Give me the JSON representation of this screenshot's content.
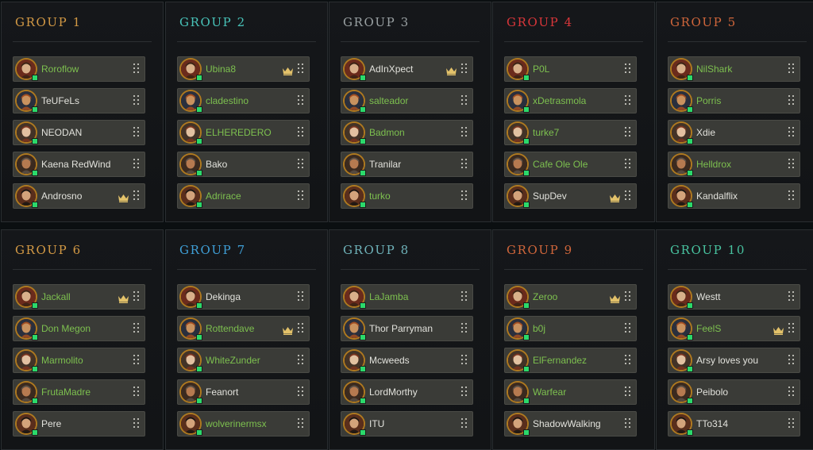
{
  "colors": {
    "gold": "#d49a45",
    "teal": "#48c3b9",
    "grey": "#9aa1a3",
    "red": "#d9363a",
    "orange": "#d0663b",
    "blue": "#3f9fd7",
    "online": "#2bd96b",
    "name_green": "#7dc04f",
    "name_white": "#e2e2dc"
  },
  "groups": [
    {
      "title": "GROUP 1",
      "color": "#d49a45",
      "players": [
        {
          "name": "Roroflow",
          "green": true,
          "crown": false,
          "avatar": "avatar-icon"
        },
        {
          "name": "TeUFeLs",
          "green": false,
          "crown": false,
          "avatar": "avatar-icon"
        },
        {
          "name": "NEODAN",
          "green": false,
          "crown": false,
          "avatar": "avatar-icon"
        },
        {
          "name": "Kaena RedWind",
          "green": false,
          "crown": false,
          "avatar": "avatar-icon"
        },
        {
          "name": "Androsno",
          "green": false,
          "crown": true,
          "avatar": "avatar-icon"
        }
      ]
    },
    {
      "title": "GROUP 2",
      "color": "#48c3b9",
      "players": [
        {
          "name": "Ubina8",
          "green": true,
          "crown": true,
          "avatar": "avatar-icon"
        },
        {
          "name": "cladestino",
          "green": true,
          "crown": false,
          "avatar": "avatar-icon"
        },
        {
          "name": "ELHEREDERO",
          "green": true,
          "crown": false,
          "avatar": "avatar-icon"
        },
        {
          "name": "Bako",
          "green": false,
          "crown": false,
          "avatar": "avatar-icon"
        },
        {
          "name": "Adrirace",
          "green": true,
          "crown": false,
          "avatar": "avatar-icon"
        }
      ]
    },
    {
      "title": "GROUP 3",
      "color": "#9aa1a3",
      "players": [
        {
          "name": "AdInXpect",
          "green": false,
          "crown": true,
          "avatar": "avatar-icon"
        },
        {
          "name": "salteador",
          "green": true,
          "crown": false,
          "avatar": "avatar-icon"
        },
        {
          "name": "Badmon",
          "green": true,
          "crown": false,
          "avatar": "avatar-icon"
        },
        {
          "name": "Tranilar",
          "green": false,
          "crown": false,
          "avatar": "avatar-icon"
        },
        {
          "name": "turko",
          "green": true,
          "crown": false,
          "avatar": "avatar-icon"
        }
      ]
    },
    {
      "title": "GROUP 4",
      "color": "#d9363a",
      "players": [
        {
          "name": "P0L",
          "green": true,
          "crown": false,
          "avatar": "avatar-icon"
        },
        {
          "name": "xDetrasmola",
          "green": true,
          "crown": false,
          "avatar": "avatar-icon"
        },
        {
          "name": "turke7",
          "green": true,
          "crown": false,
          "avatar": "avatar-icon"
        },
        {
          "name": "Cafe Ole Ole",
          "green": true,
          "crown": false,
          "avatar": "avatar-icon"
        },
        {
          "name": "SupDev",
          "green": false,
          "crown": true,
          "avatar": "avatar-icon"
        }
      ]
    },
    {
      "title": "GROUP 5",
      "color": "#d0663b",
      "players": [
        {
          "name": "NilShark",
          "green": true,
          "crown": false,
          "avatar": "avatar-icon"
        },
        {
          "name": "Porris",
          "green": true,
          "crown": false,
          "avatar": "avatar-icon"
        },
        {
          "name": "Xdie",
          "green": false,
          "crown": false,
          "avatar": "avatar-icon"
        },
        {
          "name": "Helldrox",
          "green": true,
          "crown": false,
          "avatar": "avatar-icon"
        },
        {
          "name": "Kandalflix",
          "green": false,
          "crown": false,
          "avatar": "avatar-icon"
        }
      ]
    },
    {
      "title": "GROUP 6",
      "color": "#d49a45",
      "players": [
        {
          "name": "Jackall",
          "green": true,
          "crown": true,
          "avatar": "avatar-icon"
        },
        {
          "name": "Don Megon",
          "green": true,
          "crown": false,
          "avatar": "avatar-icon"
        },
        {
          "name": "Marmolito",
          "green": true,
          "crown": false,
          "avatar": "avatar-icon"
        },
        {
          "name": "FrutaMadre",
          "green": true,
          "crown": false,
          "avatar": "avatar-icon"
        },
        {
          "name": "Pere",
          "green": false,
          "crown": false,
          "avatar": "avatar-icon"
        }
      ]
    },
    {
      "title": "GROUP 7",
      "color": "#3f9fd7",
      "players": [
        {
          "name": "Dekinga",
          "green": false,
          "crown": false,
          "avatar": "avatar-icon"
        },
        {
          "name": "Rottendave",
          "green": true,
          "crown": true,
          "avatar": "avatar-icon"
        },
        {
          "name": "WhiteZunder",
          "green": true,
          "crown": false,
          "avatar": "avatar-icon"
        },
        {
          "name": "Feanort",
          "green": false,
          "crown": false,
          "avatar": "avatar-icon"
        },
        {
          "name": "wolverinermsx",
          "green": true,
          "crown": false,
          "avatar": "avatar-icon"
        }
      ]
    },
    {
      "title": "GROUP 8",
      "color": "#6fb3ba",
      "players": [
        {
          "name": "LaJamba",
          "green": true,
          "crown": false,
          "avatar": "avatar-icon"
        },
        {
          "name": "Thor Parryman",
          "green": false,
          "crown": false,
          "avatar": "avatar-icon"
        },
        {
          "name": "Mcweeds",
          "green": false,
          "crown": false,
          "avatar": "avatar-icon"
        },
        {
          "name": "LordMorthy",
          "green": false,
          "crown": false,
          "avatar": "avatar-icon"
        },
        {
          "name": "ITU",
          "green": false,
          "crown": false,
          "avatar": "avatar-icon"
        }
      ]
    },
    {
      "title": "GROUP 9",
      "color": "#d0663b",
      "players": [
        {
          "name": "Zeroo",
          "green": true,
          "crown": true,
          "avatar": "avatar-icon"
        },
        {
          "name": "b0j",
          "green": true,
          "crown": false,
          "avatar": "avatar-icon"
        },
        {
          "name": "ElFernandez",
          "green": true,
          "crown": false,
          "avatar": "avatar-icon"
        },
        {
          "name": "Warfear",
          "green": true,
          "crown": false,
          "avatar": "avatar-icon"
        },
        {
          "name": "ShadowWalking",
          "green": false,
          "crown": false,
          "avatar": "avatar-icon"
        }
      ]
    },
    {
      "title": "GROUP 10",
      "color": "#48c3a0",
      "players": [
        {
          "name": "Westt",
          "green": false,
          "crown": false,
          "avatar": "avatar-icon"
        },
        {
          "name": "FeelS",
          "green": true,
          "crown": true,
          "avatar": "avatar-icon"
        },
        {
          "name": "Arsy loves you",
          "green": false,
          "crown": false,
          "avatar": "avatar-icon"
        },
        {
          "name": "Peibolo",
          "green": false,
          "crown": false,
          "avatar": "avatar-icon"
        },
        {
          "name": "TTo314",
          "green": false,
          "crown": false,
          "avatar": "avatar-icon"
        }
      ]
    }
  ]
}
